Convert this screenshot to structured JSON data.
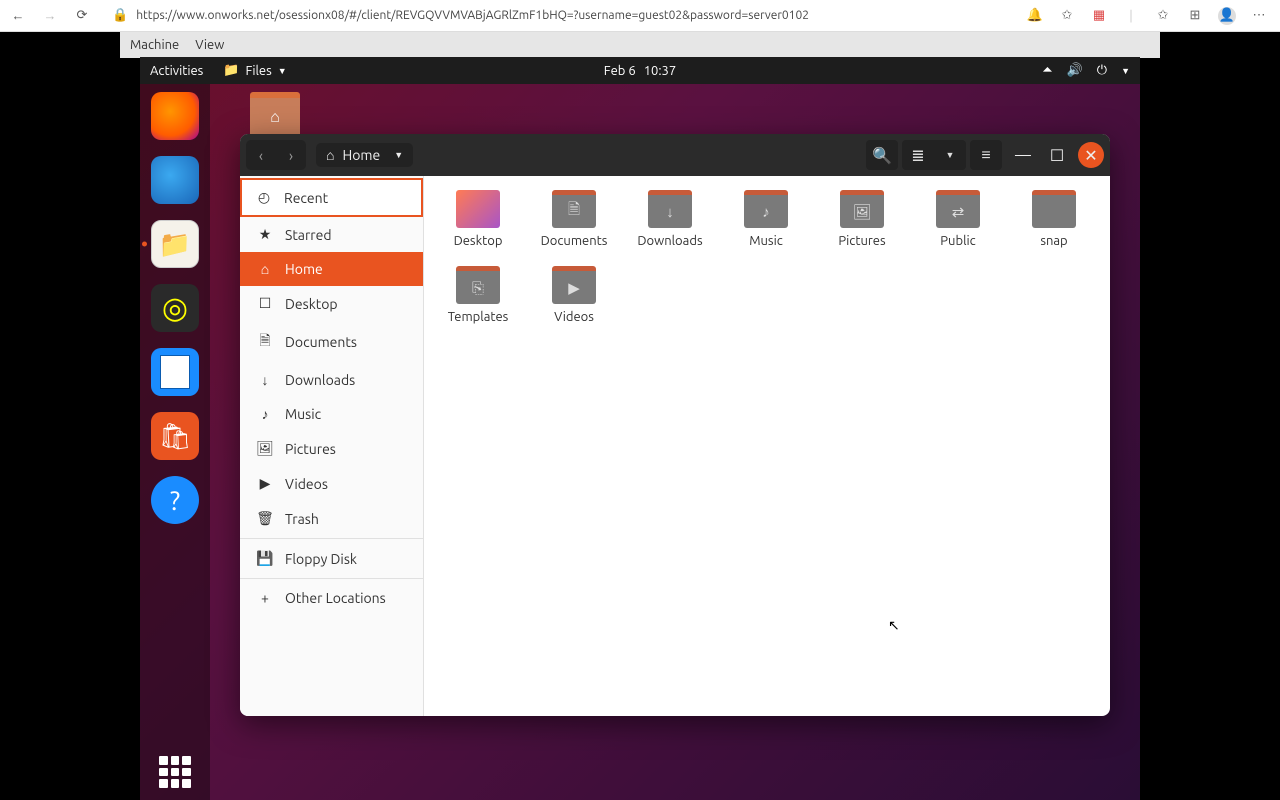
{
  "browser": {
    "url": "https://www.onworks.net/osessionx08/#/client/REVGQVVMVABjAGRlZmF1bHQ=?username=guest02&password=server0102"
  },
  "vm_menu": {
    "machine": "Machine",
    "view": "View"
  },
  "top_panel": {
    "activities": "Activities",
    "files_indicator": "Files",
    "date": "Feb 6",
    "time": "10:37"
  },
  "nautilus": {
    "path_label": "Home",
    "sidebar": [
      {
        "icon": "clock",
        "label": "Recent"
      },
      {
        "icon": "star",
        "label": "Starred"
      },
      {
        "icon": "home",
        "label": "Home"
      },
      {
        "icon": "desktop",
        "label": "Desktop"
      },
      {
        "icon": "documents",
        "label": "Documents"
      },
      {
        "icon": "downloads",
        "label": "Downloads"
      },
      {
        "icon": "music",
        "label": "Music"
      },
      {
        "icon": "pictures",
        "label": "Pictures"
      },
      {
        "icon": "videos",
        "label": "Videos"
      },
      {
        "icon": "trash",
        "label": "Trash"
      },
      {
        "icon": "floppy",
        "label": "Floppy Disk"
      },
      {
        "icon": "plus",
        "label": "Other Locations"
      }
    ],
    "folders": [
      {
        "label": "Desktop",
        "glyph": "",
        "type": "desktop"
      },
      {
        "label": "Documents",
        "glyph": "🗎"
      },
      {
        "label": "Downloads",
        "glyph": "↓"
      },
      {
        "label": "Music",
        "glyph": "♪"
      },
      {
        "label": "Pictures",
        "glyph": "🖼"
      },
      {
        "label": "Public",
        "glyph": "⇄"
      },
      {
        "label": "snap",
        "glyph": ""
      },
      {
        "label": "Templates",
        "glyph": "⎘"
      },
      {
        "label": "Videos",
        "glyph": "▶"
      }
    ]
  }
}
